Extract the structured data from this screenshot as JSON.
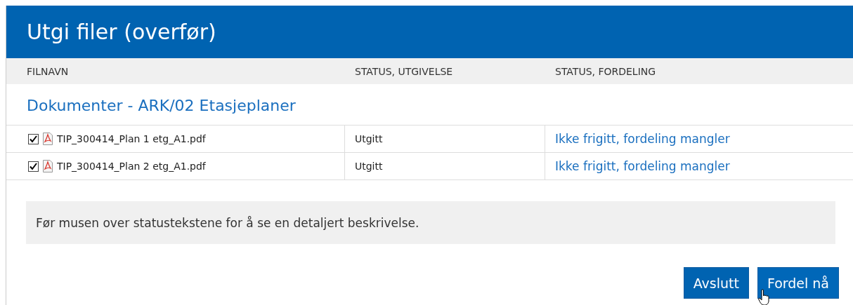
{
  "window": {
    "title": "Utgi filer (overfør)"
  },
  "table": {
    "columns": [
      "FILNAVN",
      "STATUS, UTGIVELSE",
      "STATUS, FORDELING"
    ],
    "group": "Dokumenter - ARK/02 Etasjeplaner",
    "rows": [
      {
        "checked": true,
        "file": "TIP_300414_Plan 1 etg_A1.pdf",
        "release_status": "Utgitt",
        "distribution_status": "Ikke frigitt, fordeling mangler"
      },
      {
        "checked": true,
        "file": "TIP_300414_Plan 2 etg_A1.pdf",
        "release_status": "Utgitt",
        "distribution_status": "Ikke frigitt, fordeling mangler"
      }
    ]
  },
  "info": "Før musen over statustekstene for å se en detaljert beskrivelse.",
  "buttons": [
    {
      "label": "Avslutt",
      "hovered": false
    },
    {
      "label": "Fordel nå",
      "hovered": true
    }
  ]
}
